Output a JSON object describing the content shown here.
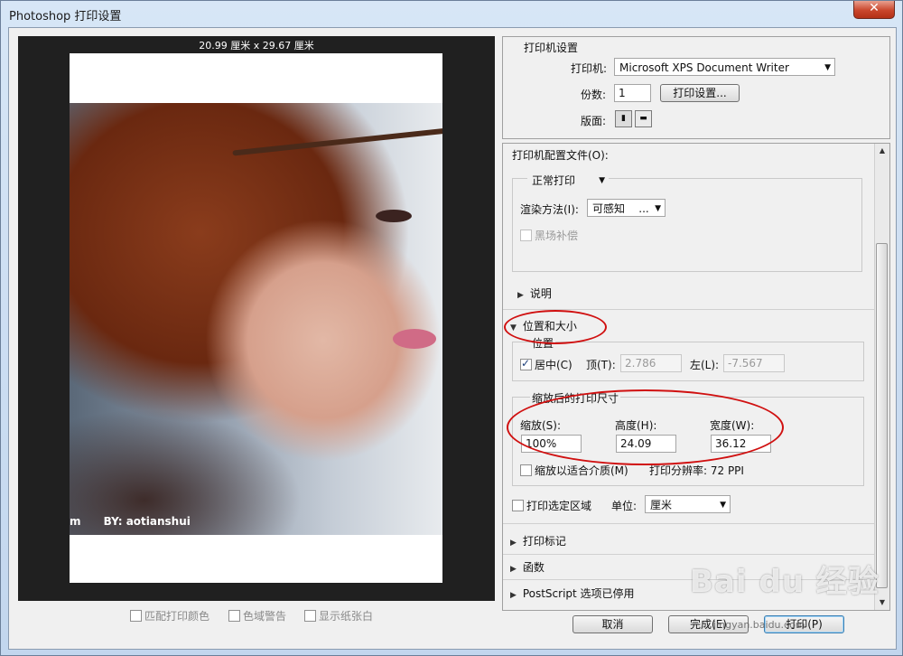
{
  "window": {
    "title": "Photoshop 打印设置",
    "close_glyph": "✕"
  },
  "preview": {
    "size_label": "20.99 厘米 x 29.67 厘米",
    "watermark": "BY: aotianshui",
    "watermark_left": "m"
  },
  "below_preview": {
    "match_colors": "匹配打印颜色",
    "gamut_warning": "色域警告",
    "show_paper_white": "显示纸张白"
  },
  "printer_settings": {
    "header": "打印机设置",
    "printer_label": "打印机:",
    "printer_value": "Microsoft XPS Document Writer",
    "copies_label": "份数:",
    "copies_value": "1",
    "print_settings_button": "打印设置...",
    "layout_label": "版面:"
  },
  "profile": {
    "header": "打印机配置文件(O):",
    "mode_value": "正常打印",
    "render_label": "渲染方法(I):",
    "render_value": "可感知",
    "render_ellipsis": "...",
    "black_point": "黑场补偿"
  },
  "sections": {
    "description": "说明",
    "position_size": "位置和大小",
    "print_marks": "打印标记",
    "functions": "函数",
    "postscript": "PostScript 选项已停用"
  },
  "position": {
    "legend": "位置",
    "center_label": "居中(C)",
    "center_checked": true,
    "top_label": "顶(T):",
    "top_value": "2.786",
    "left_label": "左(L):",
    "left_value": "-7.567"
  },
  "scaled_size": {
    "legend": "缩放后的打印尺寸",
    "scale_label": "缩放(S):",
    "scale_value": "100%",
    "height_label": "高度(H):",
    "height_value": "24.09",
    "width_label": "宽度(W):",
    "width_value": "36.12",
    "fit_media": "缩放以适合介质(M)",
    "resolution": "打印分辨率: 72 PPI"
  },
  "print_selection": {
    "label": "打印选定区域",
    "unit_label": "单位:",
    "unit_value": "厘米"
  },
  "buttons": {
    "cancel": "取消",
    "done": "完成(E)",
    "print": "打印(P)"
  },
  "watermark_site": {
    "brand": "Bai du 经验",
    "url": "jingyan.baidu.com"
  },
  "annotation_color": "#d01010"
}
